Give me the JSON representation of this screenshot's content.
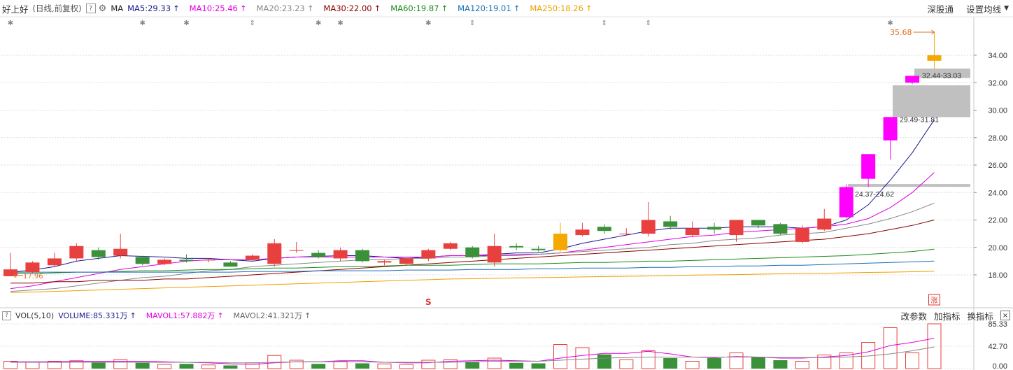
{
  "header": {
    "stock_name": "好上好",
    "mode": "(日线,前复权)",
    "help": "?",
    "ma_label": "MA",
    "ma_items": [
      {
        "text": "MA5:29.33",
        "color": "#1a1a8c"
      },
      {
        "text": "MA10:25.46",
        "color": "#e000e0"
      },
      {
        "text": "MA20:23.23",
        "color": "#888888"
      },
      {
        "text": "MA30:22.00",
        "color": "#8b0000"
      },
      {
        "text": "MA60:19.87",
        "color": "#1a8a1a"
      },
      {
        "text": "MA120:19.01",
        "color": "#1a6fb5"
      },
      {
        "text": "MA250:18.26",
        "color": "#f0a000"
      }
    ],
    "right_buttons": [
      "深股通",
      "设置均线"
    ]
  },
  "volume_header": {
    "help": "?",
    "name": "VOL(5,10)",
    "items": [
      {
        "text": "VOLUME:85.331万",
        "color": "#1a1a8c"
      },
      {
        "text": "MAVOL1:57.882万",
        "color": "#e000e0"
      },
      {
        "text": "MAVOL2:41.321万",
        "color": "#666666"
      }
    ],
    "right_buttons": [
      "改参数",
      "加指标",
      "换指标"
    ],
    "close": "×"
  },
  "chart_data": {
    "type": "candlestick",
    "y_ticks": [
      "34.00",
      "32.00",
      "30.00",
      "28.00",
      "26.00",
      "24.00",
      "22.00",
      "20.00",
      "18.00"
    ],
    "ylim": [
      16.5,
      35.8
    ],
    "vol_ticks": [
      "85.33",
      "42.70",
      "0.00"
    ],
    "vol_max": 85.33,
    "annotations": {
      "high": "35.68",
      "low": "17.96",
      "zones": [
        "32.44-33.03",
        "29.49-31.81",
        "24.37-24.62"
      ],
      "marker_s": "S",
      "marker_zhang": "涨"
    },
    "candles": [
      {
        "o": 17.9,
        "c": 18.4,
        "h": 19.6,
        "l": 17.96,
        "v": 14
      },
      {
        "o": 18.2,
        "c": 18.9,
        "h": 19.0,
        "l": 18.1,
        "v": 12
      },
      {
        "o": 18.7,
        "c": 19.2,
        "h": 19.6,
        "l": 18.6,
        "v": 14
      },
      {
        "o": 19.2,
        "c": 20.1,
        "h": 20.3,
        "l": 19.0,
        "v": 15
      },
      {
        "o": 19.8,
        "c": 19.3,
        "h": 20.0,
        "l": 19.1,
        "v": 12
      },
      {
        "o": 19.4,
        "c": 19.9,
        "h": 21.0,
        "l": 19.2,
        "v": 17
      },
      {
        "o": 19.3,
        "c": 18.8,
        "h": 19.4,
        "l": 18.7,
        "v": 11
      },
      {
        "o": 18.8,
        "c": 19.1,
        "h": 19.2,
        "l": 18.7,
        "v": 8
      },
      {
        "o": 19.1,
        "c": 19.0,
        "h": 19.5,
        "l": 18.9,
        "v": 9
      },
      {
        "o": 19.1,
        "c": 19.1,
        "h": 19.2,
        "l": 18.9,
        "v": 7
      },
      {
        "o": 18.9,
        "c": 18.6,
        "h": 19.0,
        "l": 18.6,
        "v": 6
      },
      {
        "o": 19.1,
        "c": 19.4,
        "h": 19.5,
        "l": 19.0,
        "v": 11
      },
      {
        "o": 18.8,
        "c": 20.3,
        "h": 20.6,
        "l": 18.6,
        "v": 25
      },
      {
        "o": 19.8,
        "c": 19.8,
        "h": 20.4,
        "l": 19.6,
        "v": 16
      },
      {
        "o": 19.6,
        "c": 19.3,
        "h": 19.8,
        "l": 19.2,
        "v": 9
      },
      {
        "o": 19.2,
        "c": 19.8,
        "h": 20.0,
        "l": 19.0,
        "v": 14
      },
      {
        "o": 19.8,
        "c": 19.0,
        "h": 19.9,
        "l": 18.9,
        "v": 10
      },
      {
        "o": 18.9,
        "c": 19.0,
        "h": 19.1,
        "l": 18.7,
        "v": 9
      },
      {
        "o": 18.8,
        "c": 19.2,
        "h": 19.3,
        "l": 18.7,
        "v": 8
      },
      {
        "o": 19.2,
        "c": 19.8,
        "h": 19.9,
        "l": 19.0,
        "v": 16
      },
      {
        "o": 19.9,
        "c": 20.3,
        "h": 20.4,
        "l": 19.8,
        "v": 17
      },
      {
        "o": 20.0,
        "c": 19.3,
        "h": 20.1,
        "l": 19.2,
        "v": 12
      },
      {
        "o": 18.9,
        "c": 20.1,
        "h": 21.0,
        "l": 18.6,
        "v": 20
      },
      {
        "o": 20.1,
        "c": 20.0,
        "h": 20.3,
        "l": 19.8,
        "v": 11
      },
      {
        "o": 19.9,
        "c": 19.8,
        "h": 20.1,
        "l": 19.7,
        "v": 10
      },
      {
        "o": 19.8,
        "c": 21.0,
        "h": 21.8,
        "l": 19.7,
        "v": 46
      },
      {
        "o": 20.9,
        "c": 21.3,
        "h": 21.8,
        "l": 20.8,
        "v": 40
      },
      {
        "o": 21.5,
        "c": 21.2,
        "h": 21.7,
        "l": 21.0,
        "v": 27
      },
      {
        "o": 21.0,
        "c": 21.0,
        "h": 21.4,
        "l": 20.9,
        "v": 17
      },
      {
        "o": 21.0,
        "c": 22.0,
        "h": 23.3,
        "l": 20.8,
        "v": 34
      },
      {
        "o": 21.9,
        "c": 21.5,
        "h": 22.3,
        "l": 21.3,
        "v": 20
      },
      {
        "o": 20.9,
        "c": 21.4,
        "h": 21.9,
        "l": 20.8,
        "v": 14
      },
      {
        "o": 21.5,
        "c": 21.3,
        "h": 21.8,
        "l": 21.0,
        "v": 20
      },
      {
        "o": 20.9,
        "c": 22.0,
        "h": 22.0,
        "l": 20.4,
        "v": 30
      },
      {
        "o": 22.0,
        "c": 21.6,
        "h": 22.0,
        "l": 21.4,
        "v": 22
      },
      {
        "o": 21.7,
        "c": 21.0,
        "h": 21.8,
        "l": 20.9,
        "v": 16
      },
      {
        "o": 20.4,
        "c": 21.4,
        "h": 21.6,
        "l": 20.3,
        "v": 14
      },
      {
        "o": 21.3,
        "c": 22.1,
        "h": 22.8,
        "l": 21.2,
        "v": 26
      },
      {
        "o": 22.2,
        "c": 24.4,
        "h": 24.6,
        "l": 22.1,
        "v": 30
      },
      {
        "o": 25.0,
        "c": 26.8,
        "h": 26.8,
        "l": 24.4,
        "v": 50
      },
      {
        "o": 27.8,
        "c": 29.5,
        "h": 29.5,
        "l": 26.4,
        "v": 78
      },
      {
        "o": 32.0,
        "c": 32.5,
        "h": 32.5,
        "l": 31.9,
        "v": 30
      },
      {
        "o": 33.6,
        "c": 34.0,
        "h": 35.68,
        "l": 33.0,
        "v": 85.33
      }
    ],
    "ma_lines": [
      {
        "name": "MA5",
        "color": "#1a1a8c",
        "values": [
          18.2,
          18.35,
          18.6,
          19.0,
          19.2,
          19.4,
          19.35,
          19.3,
          19.2,
          19.2,
          19.1,
          19.0,
          19.2,
          19.3,
          19.35,
          19.4,
          19.4,
          19.3,
          19.2,
          19.3,
          19.4,
          19.4,
          19.5,
          19.6,
          19.6,
          19.9,
          20.3,
          20.6,
          20.9,
          21.2,
          21.4,
          21.4,
          21.4,
          21.5,
          21.5,
          21.5,
          21.4,
          21.5,
          22.0,
          23.1,
          24.9,
          26.9,
          29.3
        ]
      },
      {
        "name": "MA10",
        "color": "#e000e0",
        "values": [
          17.0,
          17.2,
          17.5,
          17.8,
          18.1,
          18.4,
          18.6,
          18.8,
          19.0,
          19.1,
          19.1,
          19.1,
          19.2,
          19.3,
          19.3,
          19.3,
          19.3,
          19.3,
          19.3,
          19.3,
          19.4,
          19.4,
          19.4,
          19.5,
          19.5,
          19.6,
          19.8,
          20.0,
          20.2,
          20.4,
          20.6,
          20.8,
          20.9,
          21.1,
          21.2,
          21.3,
          21.4,
          21.5,
          21.7,
          22.1,
          22.9,
          24.0,
          25.46
        ]
      },
      {
        "name": "MA20",
        "color": "#888888",
        "values": [
          16.8,
          16.9,
          17.0,
          17.2,
          17.4,
          17.6,
          17.8,
          17.9,
          18.1,
          18.3,
          18.4,
          18.6,
          18.7,
          18.8,
          18.9,
          19.0,
          19.1,
          19.1,
          19.2,
          19.2,
          19.3,
          19.3,
          19.4,
          19.4,
          19.5,
          19.6,
          19.7,
          19.8,
          19.9,
          20.0,
          20.2,
          20.3,
          20.5,
          20.6,
          20.7,
          20.9,
          21.0,
          21.1,
          21.4,
          21.7,
          22.1,
          22.6,
          23.23
        ]
      },
      {
        "name": "MA30",
        "color": "#8b0000",
        "values": [
          17.4,
          17.4,
          17.5,
          17.5,
          17.6,
          17.6,
          17.6,
          17.7,
          17.7,
          17.8,
          17.9,
          18.0,
          18.1,
          18.2,
          18.3,
          18.4,
          18.5,
          18.6,
          18.7,
          18.8,
          18.9,
          19.0,
          19.1,
          19.2,
          19.3,
          19.4,
          19.5,
          19.6,
          19.7,
          19.8,
          19.9,
          20.0,
          20.1,
          20.2,
          20.3,
          20.4,
          20.5,
          20.6,
          20.8,
          21.0,
          21.3,
          21.6,
          22.0
        ]
      },
      {
        "name": "MA60",
        "color": "#1a8a1a",
        "values": [
          18.1,
          18.1,
          18.15,
          18.2,
          18.2,
          18.25,
          18.3,
          18.3,
          18.35,
          18.4,
          18.4,
          18.45,
          18.5,
          18.5,
          18.55,
          18.6,
          18.6,
          18.65,
          18.7,
          18.7,
          18.7,
          18.75,
          18.8,
          18.8,
          18.8,
          18.85,
          18.9,
          18.9,
          18.95,
          19.0,
          19.0,
          19.05,
          19.1,
          19.15,
          19.2,
          19.25,
          19.3,
          19.35,
          19.4,
          19.5,
          19.6,
          19.7,
          19.87
        ]
      },
      {
        "name": "MA120",
        "color": "#1a6fb5",
        "values": [
          18.2,
          18.2,
          18.2,
          18.2,
          18.2,
          18.2,
          18.2,
          18.2,
          18.2,
          18.2,
          18.2,
          18.25,
          18.25,
          18.25,
          18.3,
          18.3,
          18.3,
          18.3,
          18.35,
          18.35,
          18.35,
          18.4,
          18.4,
          18.4,
          18.45,
          18.45,
          18.5,
          18.5,
          18.5,
          18.55,
          18.55,
          18.6,
          18.6,
          18.65,
          18.65,
          18.7,
          18.7,
          18.75,
          18.8,
          18.85,
          18.9,
          18.95,
          19.01
        ]
      },
      {
        "name": "MA250",
        "color": "#f0a000",
        "values": [
          16.7,
          16.75,
          16.8,
          16.85,
          16.9,
          16.95,
          17.0,
          17.05,
          17.1,
          17.15,
          17.2,
          17.25,
          17.3,
          17.35,
          17.4,
          17.45,
          17.5,
          17.55,
          17.6,
          17.65,
          17.7,
          17.72,
          17.75,
          17.78,
          17.8,
          17.82,
          17.85,
          17.88,
          17.9,
          17.92,
          17.95,
          17.98,
          18.0,
          18.02,
          18.05,
          18.08,
          18.1,
          18.12,
          18.15,
          18.18,
          18.2,
          18.23,
          18.26
        ]
      }
    ],
    "vol_ma": [
      {
        "name": "MAVOL1",
        "color": "#e000e0",
        "values": [
          13,
          13,
          13,
          14,
          14,
          14,
          14,
          13,
          12,
          11,
          9,
          8,
          11,
          13,
          13,
          15,
          15,
          12,
          11,
          11,
          14,
          15,
          16,
          15,
          14,
          20,
          25,
          29,
          29,
          33,
          28,
          22,
          21,
          23,
          22,
          20,
          20,
          22,
          25,
          32,
          44,
          50,
          57.88
        ]
      },
      {
        "name": "MAVOL2",
        "color": "#888888",
        "values": [
          12,
          12,
          12,
          12,
          12,
          12,
          12,
          12,
          12,
          12,
          11,
          11,
          12,
          13,
          13,
          13,
          13,
          12,
          12,
          12,
          12,
          13,
          14,
          14,
          14,
          16,
          18,
          20,
          21,
          22,
          22,
          22,
          22,
          22,
          22,
          21,
          21,
          21,
          22,
          24,
          28,
          34,
          41.32
        ]
      }
    ]
  }
}
